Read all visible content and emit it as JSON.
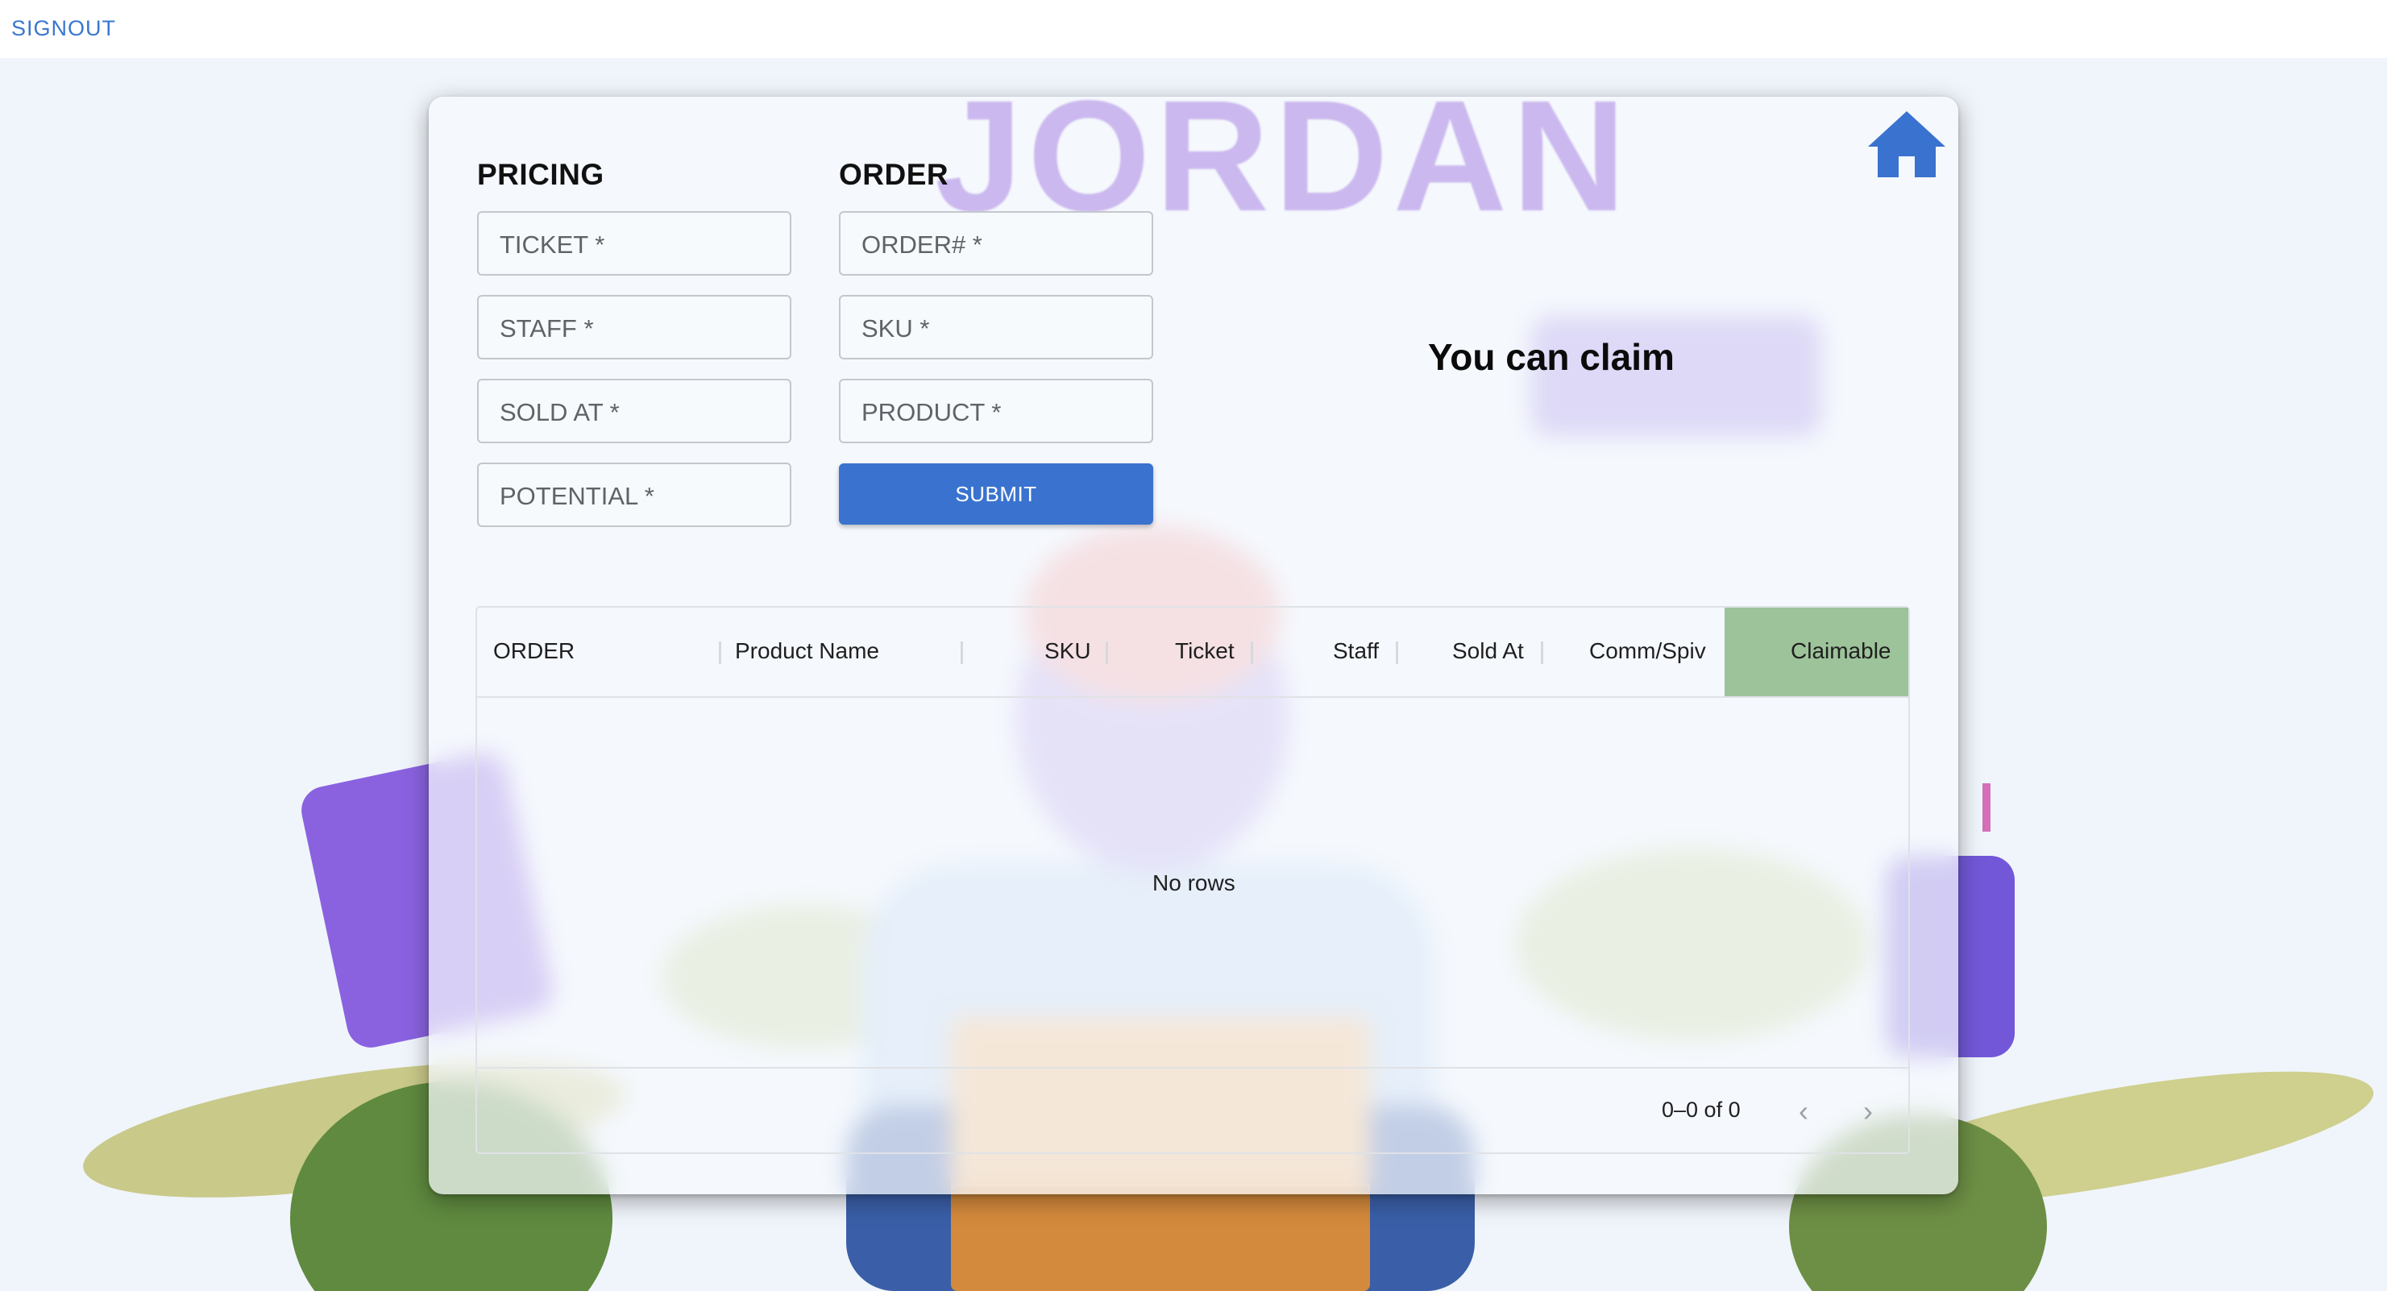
{
  "topbar": {
    "signout_label": "SIGNOUT"
  },
  "watermark": "JORDAN",
  "pricing": {
    "title": "PRICING",
    "fields": [
      {
        "placeholder": "TICKET *"
      },
      {
        "placeholder": "STAFF *"
      },
      {
        "placeholder": "SOLD AT *"
      },
      {
        "placeholder": "POTENTIAL *"
      }
    ]
  },
  "order": {
    "title": "ORDER",
    "fields": [
      {
        "placeholder": "ORDER# *"
      },
      {
        "placeholder": "SKU *"
      },
      {
        "placeholder": "PRODUCT *"
      }
    ],
    "submit_label": "SUBMIT"
  },
  "claim_text": "You can claim",
  "icons": {
    "home": "home-icon",
    "prev": "chevron-left-icon",
    "next": "chevron-right-icon"
  },
  "colors": {
    "accent": "#3a73cf",
    "claimable_header": "#9dc39a"
  },
  "grid": {
    "columns": [
      "ORDER",
      "Product Name",
      "SKU",
      "Ticket",
      "Staff",
      "Sold At",
      "Comm/Spiv",
      "Claimable"
    ],
    "empty_text": "No rows",
    "pagination": "0–0 of 0"
  }
}
